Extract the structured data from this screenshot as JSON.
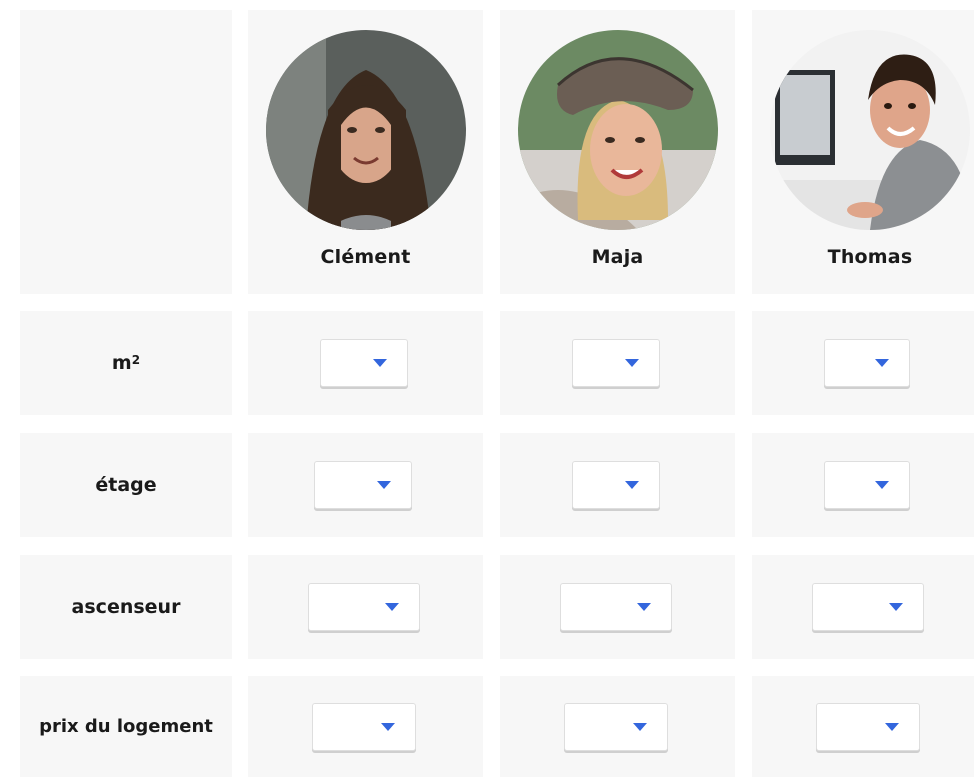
{
  "people": [
    {
      "name": "Clément",
      "avatar": "person-photo-clement"
    },
    {
      "name": "Maja",
      "avatar": "person-photo-maja"
    },
    {
      "name": "Thomas",
      "avatar": "person-photo-thomas"
    }
  ],
  "rows": [
    {
      "label": "m",
      "sup": "2"
    },
    {
      "label": "étage"
    },
    {
      "label": "ascenseur"
    },
    {
      "label": "prix du logement"
    }
  ],
  "select": {
    "arrow_icon": "caret-down-icon",
    "arrow_color": "#3366dd",
    "value": ""
  },
  "colors": {
    "cell_background": "#f7f7f7",
    "page_background": "#ffffff"
  }
}
